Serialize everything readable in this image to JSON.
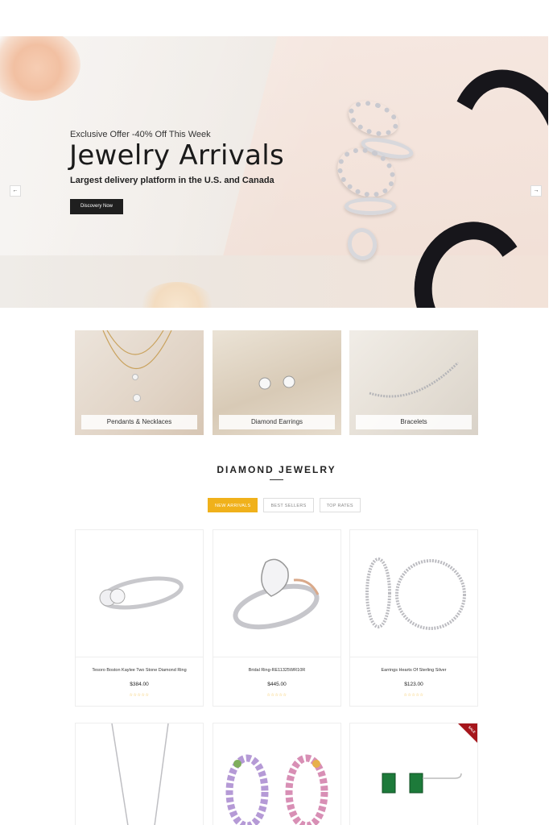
{
  "hero": {
    "subtitle": "Exclusive Offer -40% Off This Week",
    "title": "Jewelry Arrivals",
    "description": "Largest delivery platform in the U.S. and Canada",
    "button": "Discovery Now",
    "prev_arrow": "←",
    "next_arrow": "→"
  },
  "categories": [
    {
      "label": "Pendants & Necklaces"
    },
    {
      "label": "Diamond Earrings"
    },
    {
      "label": "Bracelets"
    }
  ],
  "section": {
    "title": "DIAMOND JEWELRY",
    "tabs": [
      {
        "label": "NEW ARRIVALS",
        "active": true
      },
      {
        "label": "BEST SELLERS",
        "active": false
      },
      {
        "label": "TOP RATES",
        "active": false
      }
    ]
  },
  "products": [
    {
      "name": "Tesoro Boston Kaylee Two Stone Diamond Ring",
      "price": "$384.00",
      "rating": "☆☆☆☆☆"
    },
    {
      "name": "Bridal Ring-RE11325WR10R",
      "price": "$445.00",
      "rating": "☆☆☆☆☆"
    },
    {
      "name": "Earrings Hearts Of Sterling Silver",
      "price": "$123.00",
      "rating": "☆☆☆☆☆"
    }
  ],
  "sale_badge": "SALE",
  "colors": {
    "accent": "#f0b11b",
    "button": "#1f1f1f",
    "sale": "#a6161c"
  }
}
